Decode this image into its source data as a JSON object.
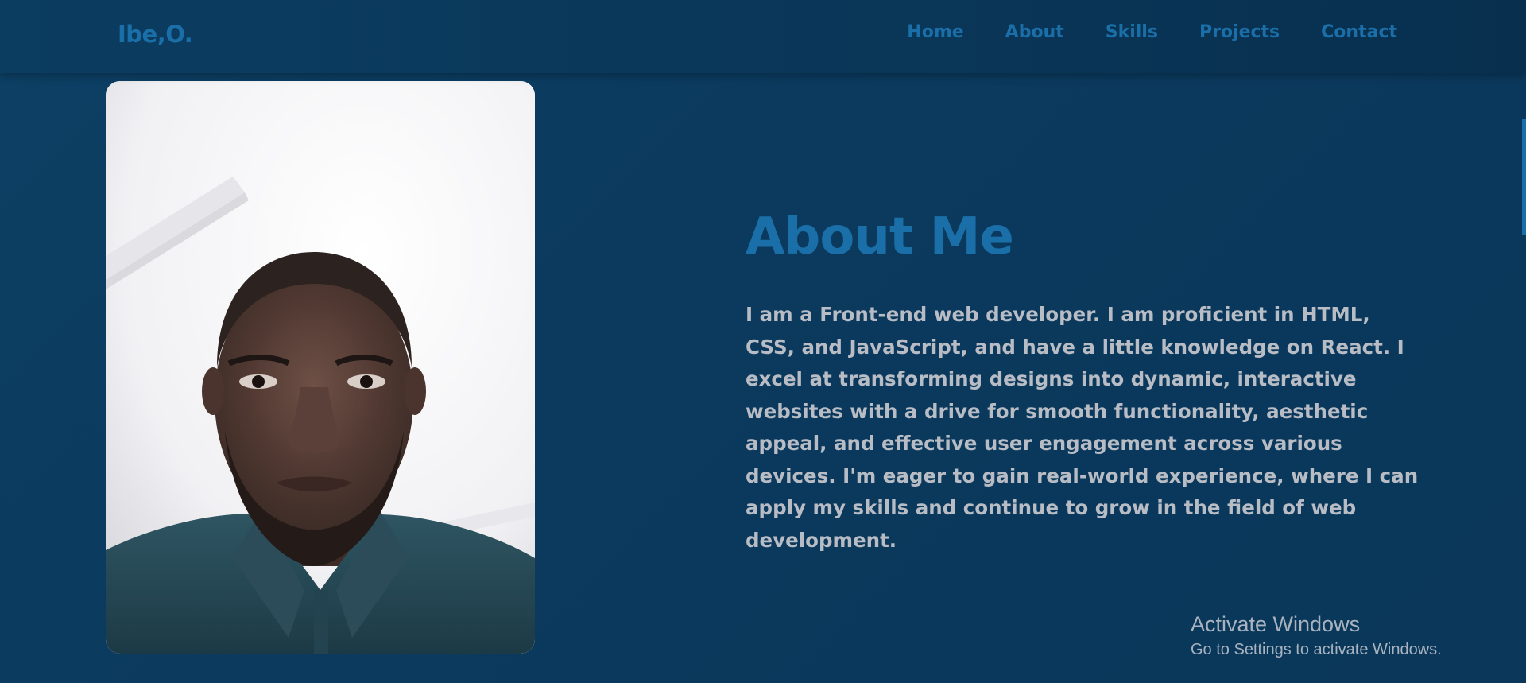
{
  "nav": {
    "logo": "Ibe,O.",
    "links": [
      {
        "label": "Home"
      },
      {
        "label": "About"
      },
      {
        "label": "Skills"
      },
      {
        "label": "Projects"
      },
      {
        "label": "Contact"
      }
    ]
  },
  "about": {
    "title": "About Me",
    "text": "I am a Front-end web developer. I am proficient in HTML, CSS, and JavaScript, and have a little knowledge on React. I excel at transforming designs into dynamic, interactive websites with a drive for smooth functionality, aesthetic appeal, and effective user engagement across various devices. I'm eager to gain real-world experience, where I can apply my skills and continue to grow in the field of web development."
  },
  "watermark": {
    "title": "Activate Windows",
    "subtitle": "Go to Settings to activate Windows."
  },
  "colors": {
    "accent": "#1a6fa8",
    "background": "#0b3a5e",
    "text": "#b8bcc4"
  }
}
